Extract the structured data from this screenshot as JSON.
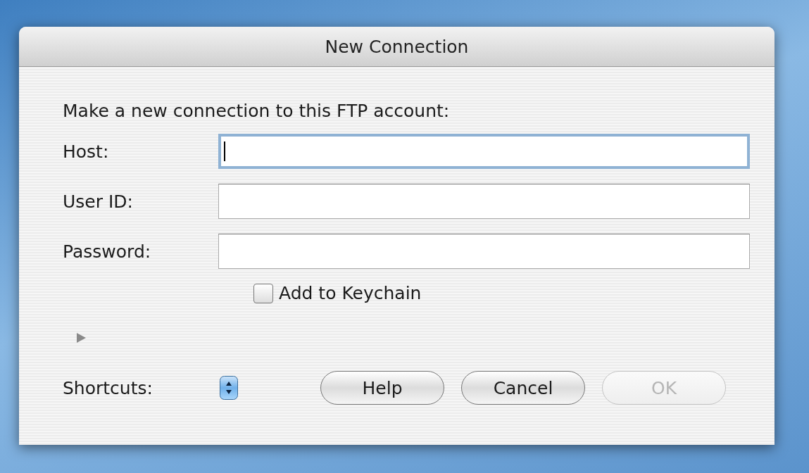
{
  "window": {
    "title": "New Connection"
  },
  "intro": "Make a new connection to this FTP account:",
  "fields": [
    {
      "label": "Host:",
      "focused": true
    },
    {
      "label": "User ID:",
      "focused": false
    },
    {
      "label": "Password:",
      "focused": false
    }
  ],
  "keychain": {
    "label": "Add to Keychain",
    "checked": false
  },
  "disclosure": {
    "expanded": false
  },
  "shortcuts": {
    "label": "Shortcuts:"
  },
  "buttons": [
    {
      "label": "Help",
      "disabled": false
    },
    {
      "label": "Cancel",
      "disabled": false
    },
    {
      "label": "OK",
      "disabled": true
    }
  ]
}
